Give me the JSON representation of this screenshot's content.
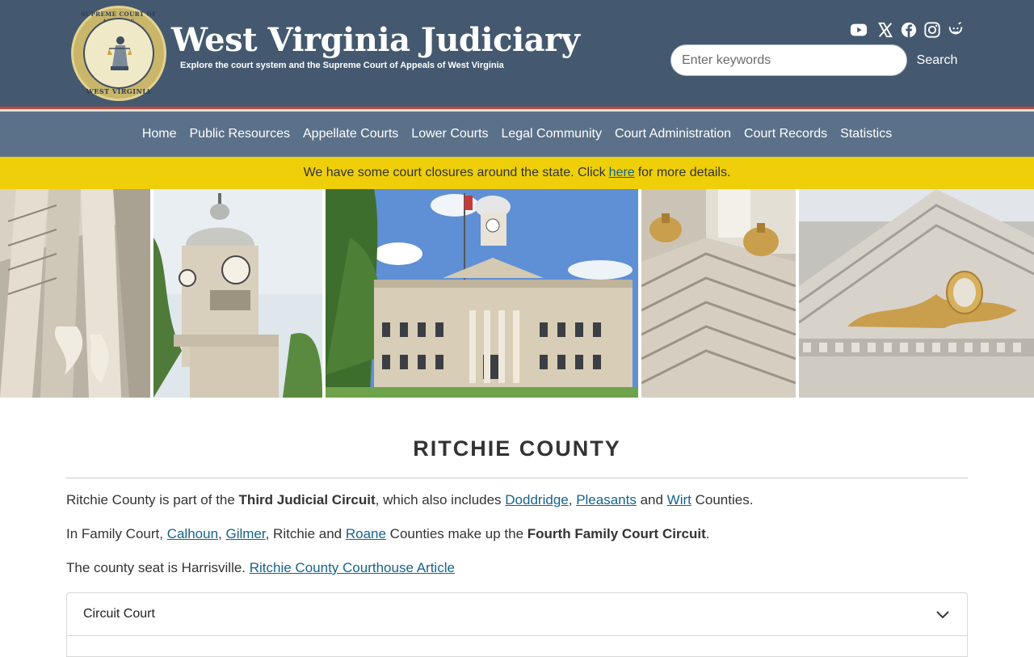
{
  "header": {
    "seal_text_top": "SUPREME COURT OF APPEALS",
    "seal_text_bottom": "WEST VIRGINIA",
    "title": "West Virginia Judiciary",
    "tagline": "Explore the court system and the Supreme Court of Appeals of West Virginia",
    "social_icons": [
      "youtube-icon",
      "x-icon",
      "facebook-icon",
      "instagram-icon",
      "smile-icon"
    ],
    "search": {
      "placeholder": "Enter keywords",
      "value": "",
      "button_label": "Search"
    }
  },
  "nav": {
    "items": [
      {
        "label": "Home"
      },
      {
        "label": "Public Resources"
      },
      {
        "label": "Appellate Courts"
      },
      {
        "label": "Lower Courts"
      },
      {
        "label": "Legal Community"
      },
      {
        "label": "Court Administration"
      },
      {
        "label": "Court Records"
      },
      {
        "label": "Statistics"
      }
    ]
  },
  "alert": {
    "text_before": "We have some court closures around the state. Click",
    "link_text": "here",
    "text_after": "for more details."
  },
  "hero": {
    "description": "courthouse-photo-collage"
  },
  "main": {
    "title": "RITCHIE COUNTY",
    "p1": {
      "t1": "Ritchie County is part of the ",
      "b1": "Third Judicial Circuit",
      "t2": ", which also includes ",
      "l1": "Doddridge",
      "t3": ", ",
      "l2": "Pleasants",
      "t4": " and ",
      "l3": "Wirt",
      "t5": " Counties."
    },
    "p2": {
      "t1": "In Family Court, ",
      "l1": "Calhoun",
      "t2": ", ",
      "l2": "Gilmer",
      "t3": ", Ritchie and ",
      "l3": "Roane",
      "t4": " Counties make up the ",
      "b1": "Fourth Family Court Circuit",
      "t5": "."
    },
    "p3": {
      "t1": "The county seat is Harrisville. ",
      "l1": "Ritchie County Courthouse Article"
    },
    "accordion": {
      "label": "Circuit Court"
    }
  },
  "colors": {
    "header_bg": "#44596f",
    "nav_bg": "#5b7189",
    "alert_bg": "#eecf0a",
    "link": "#15638c",
    "accent_red": "#c0473a"
  }
}
